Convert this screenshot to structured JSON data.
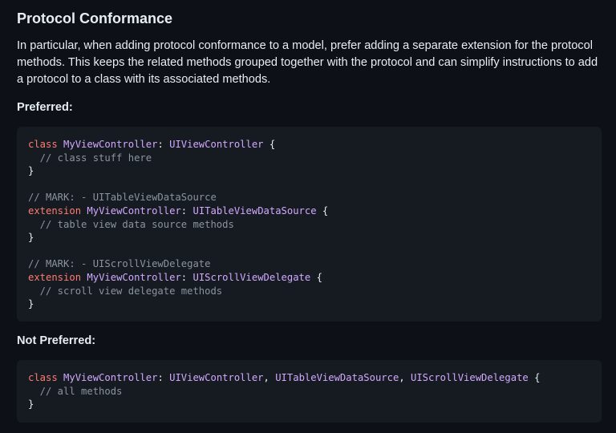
{
  "heading": "Protocol Conformance",
  "paragraph": "In particular, when adding protocol conformance to a model, prefer adding a separate extension for the protocol methods. This keeps the related methods grouped together with the protocol and can simplify instructions to add a protocol to a class with its associated methods.",
  "preferred_label": "Preferred:",
  "not_preferred_label": "Not Preferred:",
  "preferred_code": {
    "l1": {
      "kw": "class",
      "name": "MyViewController",
      "colon": ":",
      "parent": "UIViewController",
      "brace": " {"
    },
    "l2": "  // class stuff here",
    "l3": "}",
    "l5": "// MARK: - UITableViewDataSource",
    "l6": {
      "kw": "extension",
      "name": "MyViewController",
      "colon": ":",
      "parent": "UITableViewDataSource",
      "brace": " {"
    },
    "l7": "  // table view data source methods",
    "l8": "}",
    "l10": "// MARK: - UIScrollViewDelegate",
    "l11": {
      "kw": "extension",
      "name": "MyViewController",
      "colon": ":",
      "parent": "UIScrollViewDelegate",
      "brace": " {"
    },
    "l12": "  // scroll view delegate methods",
    "l13": "}"
  },
  "not_preferred_code": {
    "l1": {
      "kw": "class",
      "name": "MyViewController",
      "colon": ":",
      "p1": "UIViewController",
      "sep1": ", ",
      "p2": "UITableViewDataSource",
      "sep2": ", ",
      "p3": "UIScrollViewDelegate",
      "brace": " {"
    },
    "l2": "  // all methods",
    "l3": "}"
  }
}
